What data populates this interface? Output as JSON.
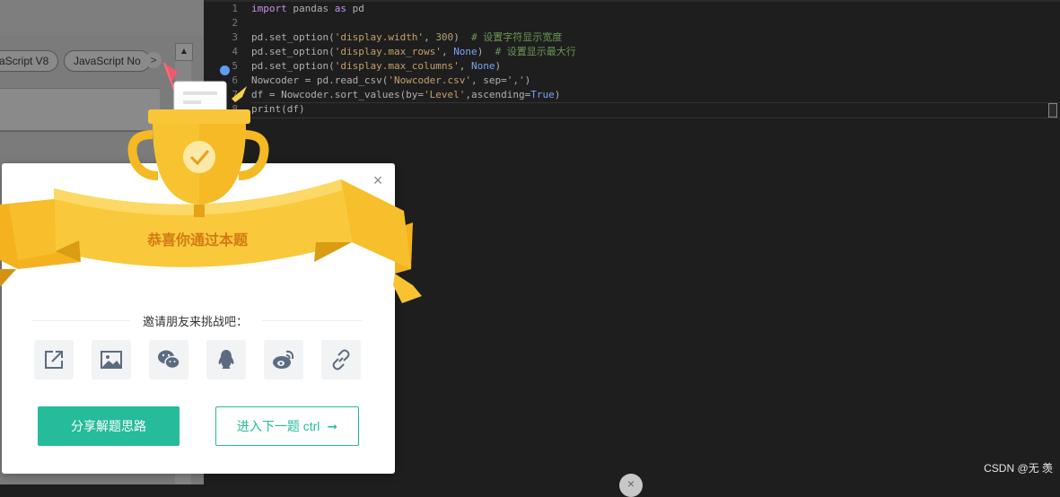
{
  "tabs": {
    "chip1": "aScript V8",
    "chip2": "JavaScript No",
    "more_arrow": ">",
    "scroll_up": "▲"
  },
  "editor": {
    "lines": [
      {
        "n": "1",
        "tokens": [
          {
            "t": "import",
            "c": "kw"
          },
          {
            "t": " pandas ",
            "c": ""
          },
          {
            "t": "as",
            "c": "kw"
          },
          {
            "t": " pd",
            "c": ""
          }
        ]
      },
      {
        "n": "2",
        "tokens": []
      },
      {
        "n": "3",
        "tokens": [
          {
            "t": "pd.set_option(",
            "c": ""
          },
          {
            "t": "'display.width'",
            "c": "str"
          },
          {
            "t": ", ",
            "c": ""
          },
          {
            "t": "300",
            "c": "num"
          },
          {
            "t": ")  ",
            "c": ""
          },
          {
            "t": "# 设置字符显示宽度",
            "c": "cmt"
          }
        ]
      },
      {
        "n": "4",
        "tokens": [
          {
            "t": "pd.set_option(",
            "c": ""
          },
          {
            "t": "'display.max_rows'",
            "c": "str"
          },
          {
            "t": ", ",
            "c": ""
          },
          {
            "t": "None",
            "c": "cst"
          },
          {
            "t": ")  ",
            "c": ""
          },
          {
            "t": "# 设置显示最大行",
            "c": "cmt"
          }
        ]
      },
      {
        "n": "5",
        "tokens": [
          {
            "t": "pd.set_option(",
            "c": ""
          },
          {
            "t": "'display.max_columns'",
            "c": "str"
          },
          {
            "t": ", ",
            "c": ""
          },
          {
            "t": "None",
            "c": "cst"
          },
          {
            "t": ")",
            "c": ""
          }
        ]
      },
      {
        "n": "6",
        "tokens": [
          {
            "t": "Nowcoder = pd.read_csv(",
            "c": ""
          },
          {
            "t": "'Nowcoder.csv'",
            "c": "str"
          },
          {
            "t": ", sep=",
            "c": ""
          },
          {
            "t": "','",
            "c": "str"
          },
          {
            "t": ")",
            "c": ""
          }
        ]
      },
      {
        "n": "7",
        "tokens": [
          {
            "t": "df = Nowcoder.sort_values(by=",
            "c": ""
          },
          {
            "t": "'Level'",
            "c": "str"
          },
          {
            "t": ",ascending=",
            "c": ""
          },
          {
            "t": "True",
            "c": "cst"
          },
          {
            "t": ")",
            "c": ""
          }
        ]
      },
      {
        "n": "8",
        "tokens": [
          {
            "t": "print",
            "c": ""
          },
          {
            "t": "(df)",
            "c": ""
          }
        ]
      }
    ]
  },
  "dialog": {
    "banner": "恭喜你通过本题",
    "invite": "邀请朋友来挑战吧：",
    "close": "×",
    "share_icons": [
      "share-external-icon",
      "image-icon",
      "wechat-icon",
      "qq-icon",
      "weibo-icon",
      "link-icon"
    ],
    "share_button": "分享解题思路",
    "next_button": "进入下一题 ctrl",
    "next_arrow": "➞"
  },
  "watermark": "CSDN @无 羡",
  "colors": {
    "accent": "#25bb9b",
    "banner_text": "#d27a12",
    "trophy_gold": "#f7c331",
    "editor_bg": "#1e1e1e",
    "breakpoint": "#5b9cf5"
  }
}
